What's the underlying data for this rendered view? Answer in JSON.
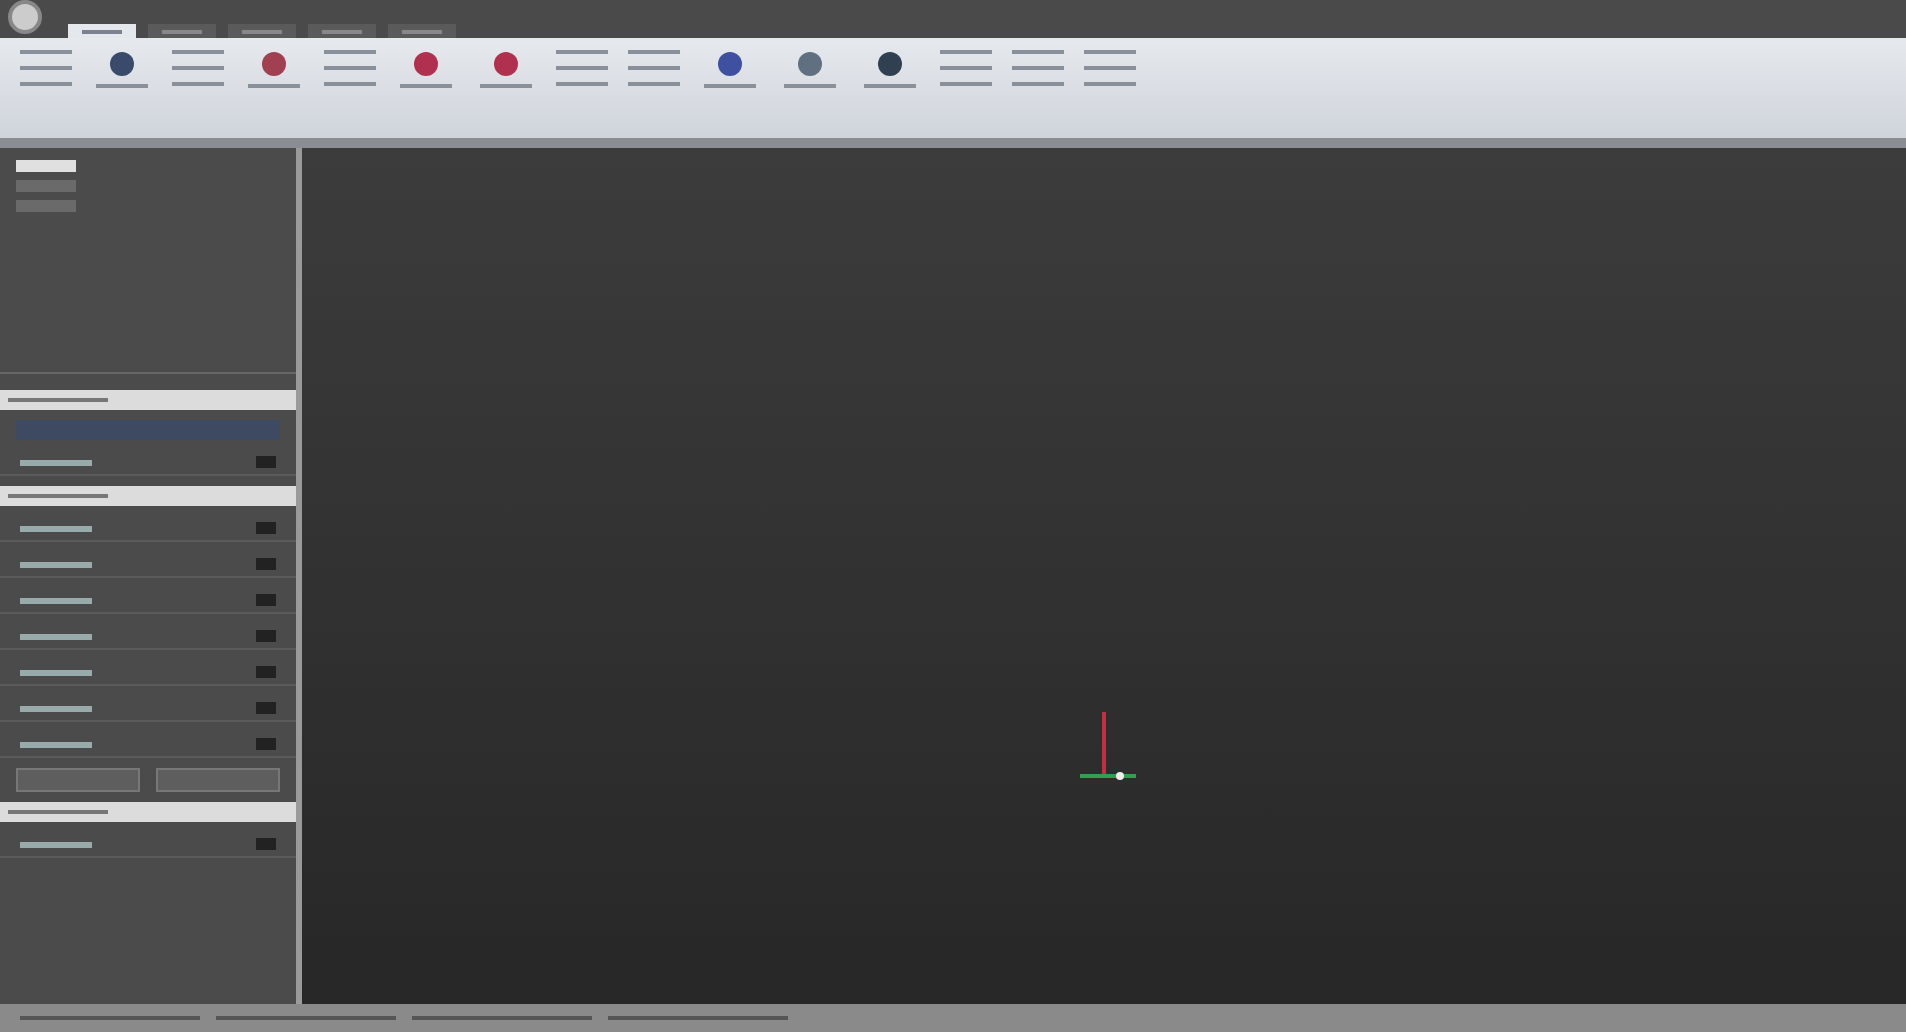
{
  "ribbon": {
    "tabs": [
      {
        "selected": true
      },
      {
        "selected": false
      },
      {
        "selected": false
      },
      {
        "selected": false
      },
      {
        "selected": false
      }
    ],
    "tools": [
      {
        "kind": "small"
      },
      {
        "kind": "large",
        "color": "#3a4a6a"
      },
      {
        "kind": "small"
      },
      {
        "kind": "large",
        "color": "#a04050"
      },
      {
        "kind": "small"
      },
      {
        "kind": "large",
        "color": "#b03050"
      },
      {
        "kind": "large",
        "color": "#b03050"
      },
      {
        "kind": "small"
      },
      {
        "kind": "small"
      },
      {
        "kind": "large",
        "color": "#4050a0"
      },
      {
        "kind": "large",
        "color": "#607080"
      },
      {
        "kind": "large",
        "color": "#304050"
      },
      {
        "kind": "small"
      },
      {
        "kind": "small"
      },
      {
        "kind": "small"
      }
    ]
  },
  "tree": {
    "items": [
      {
        "selected": true
      },
      {
        "selected": false
      },
      {
        "selected": false
      }
    ]
  },
  "panel": {
    "rows": [
      {
        "kind": "header"
      },
      {
        "kind": "bar"
      },
      {
        "kind": "row"
      },
      {
        "kind": "header"
      },
      {
        "kind": "row"
      },
      {
        "kind": "row"
      },
      {
        "kind": "row"
      },
      {
        "kind": "row"
      },
      {
        "kind": "row"
      },
      {
        "kind": "row"
      },
      {
        "kind": "row"
      },
      {
        "kind": "buttons"
      },
      {
        "kind": "header"
      },
      {
        "kind": "row"
      }
    ]
  }
}
